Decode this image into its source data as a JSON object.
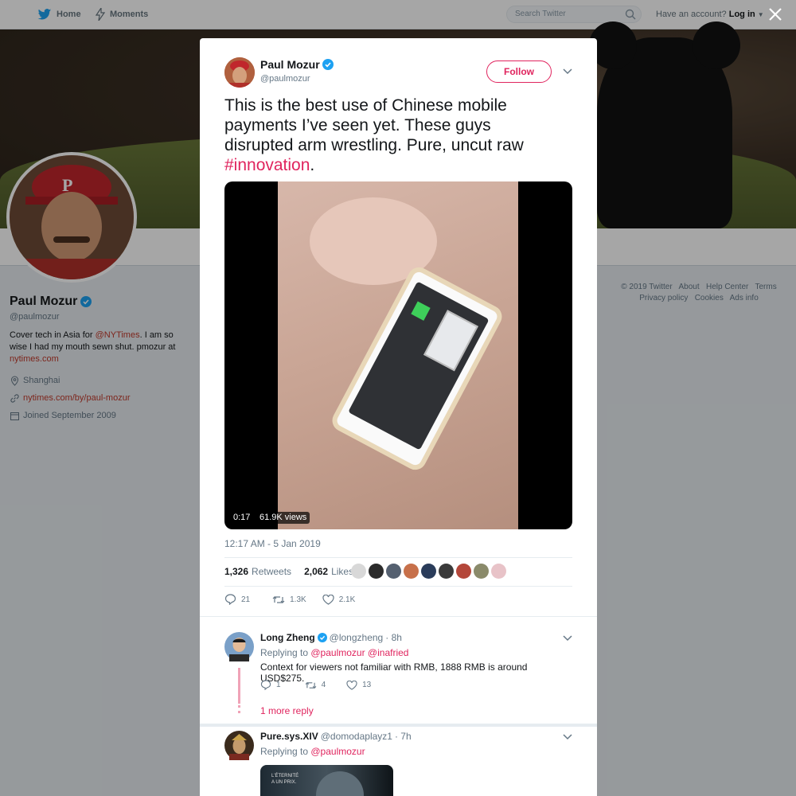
{
  "topbar": {
    "home_label": "Home",
    "moments_label": "Moments",
    "search_placeholder": "Search Twitter",
    "account_prompt": "Have an account?",
    "login_label": "Log in"
  },
  "profile": {
    "name": "Paul Mozur",
    "handle": "@paulmozur",
    "bio_part1": "Cover tech in Asia for ",
    "bio_mention": "@NYTimes",
    "bio_part2": ". I am so wise I had my mouth sewn shut. pmozur at ",
    "bio_link": "nytimes.com",
    "location": "Shanghai",
    "website": "nytimes.com/by/paul-mozur",
    "joined": "Joined September 2009"
  },
  "footer": {
    "row1": [
      "© 2019 Twitter",
      "About",
      "Help Center",
      "Terms"
    ],
    "row2": [
      "Privacy policy",
      "Cookies",
      "Ads info"
    ]
  },
  "tweet": {
    "author_name": "Paul Mozur",
    "author_handle": "@paulmozur",
    "follow_label": "Follow",
    "text": "This is the best use of Chinese mobile payments I’ve seen yet. These guys disrupted arm wrestling. Pure, uncut raw ",
    "hashtag": "#innovation",
    "text_end": ".",
    "video_duration": "0:17",
    "video_views": "61.9K views",
    "timestamp": "12:17 AM - 5 Jan 2019",
    "retweets_count": "1,326",
    "retweets_label": "Retweets",
    "likes_count": "2,062",
    "likes_label": "Likes",
    "reply_count": "21",
    "retweet_count_short": "1.3K",
    "like_count_short": "2.1K",
    "liker_colors": [
      "#d8d8d8",
      "#2b2b2b",
      "#556070",
      "#c7704a",
      "#2a3c5a",
      "#3a3a3a",
      "#b4473a",
      "#8a8a6a",
      "#e8c3c8"
    ]
  },
  "replies": [
    {
      "name": "Long Zheng",
      "handle": "@longzheng",
      "time": "· 8h",
      "replying_prefix": "Replying to ",
      "replying_to": "@paulmozur @inafried",
      "text": "Context for viewers not familiar with RMB, 1888 RMB is around USD$275.",
      "reply_count": "1",
      "retweet_count": "4",
      "like_count": "13",
      "more_replies": "1 more reply"
    },
    {
      "name": "Pure.sys.XIV",
      "handle": "@domodaplayz1",
      "time": "· 7h",
      "replying_prefix": "Replying to ",
      "replying_to": "@paulmozur",
      "media_caption": "L'ÉTERNITÉ\nA UN PRIX."
    }
  ],
  "colors": {
    "accent": "#e0245e",
    "link": "#c0392b",
    "verified": "#1da1f2",
    "muted": "#657786"
  }
}
